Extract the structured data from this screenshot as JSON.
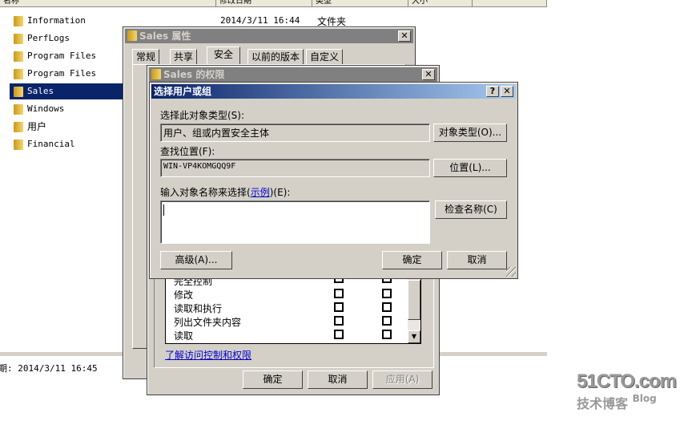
{
  "explorer": {
    "columns": [
      "名称",
      "修改日期",
      "类型",
      "大小"
    ],
    "items": [
      {
        "name": "Information",
        "date": "2014/3/11 16:44",
        "type": "文件夹"
      },
      {
        "name": "PerfLogs"
      },
      {
        "name": "Program Files"
      },
      {
        "name": "Program Files (x86)"
      },
      {
        "name": "Sales",
        "selected": true
      },
      {
        "name": "Windows"
      },
      {
        "name": "用户"
      },
      {
        "name": "Financial"
      }
    ],
    "status_text": "期: 2014/3/11 16:45"
  },
  "properties": {
    "title": "Sales 属性",
    "tabs": [
      "常规",
      "共享",
      "安全",
      "以前的版本",
      "自定义"
    ],
    "active_tab": "安全"
  },
  "permissions": {
    "title": "Sales 的权限",
    "rows": [
      "完全控制",
      "修改",
      "读取和执行",
      "列出文件夹内容",
      "读取"
    ],
    "link": "了解访问控制和权限",
    "ok": "确定",
    "cancel": "取消",
    "apply": "应用(A)"
  },
  "select_dialog": {
    "title": "选择用户或组",
    "help": "?",
    "object_type_label": "选择此对象类型(S):",
    "object_type_value": "用户、组或内置安全主体",
    "object_type_button": "对象类型(O)...",
    "location_label": "查找位置(F):",
    "location_value": "WIN-VP4KOMGQQ9F",
    "location_button": "位置(L)...",
    "names_label_pre": "输入对象名称来选择(",
    "names_label_link": "示例",
    "names_label_post": ")(E):",
    "names_value": "",
    "check_names_button": "检查名称(C)",
    "advanced_button": "高级(A)...",
    "ok": "确定",
    "cancel": "取消",
    "title_gradient": [
      "#0a246a",
      "#a6caf0"
    ]
  },
  "watermark": {
    "line1": "51CTO.com",
    "line2": "技术博客",
    "line3": "Blog"
  }
}
